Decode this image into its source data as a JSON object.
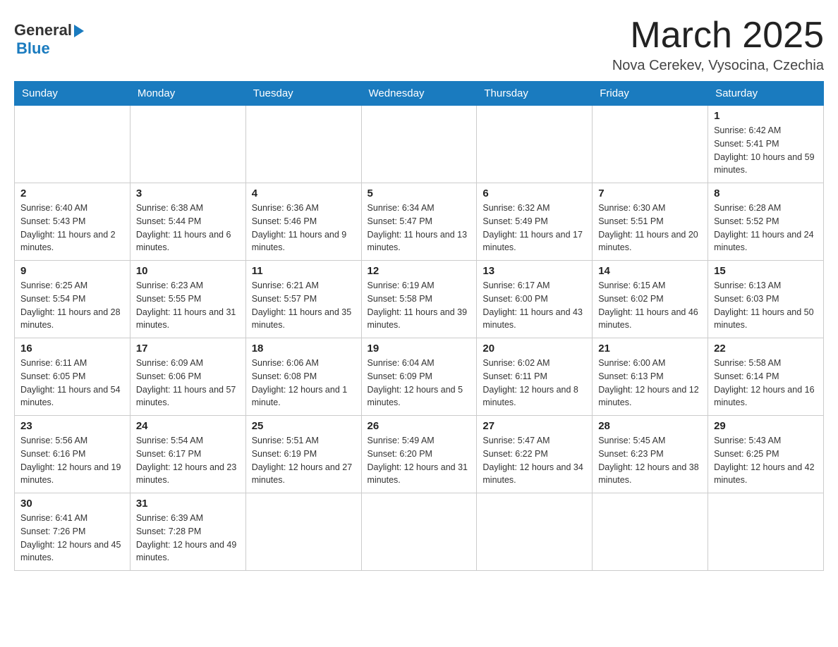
{
  "header": {
    "logo_general": "General",
    "logo_blue": "Blue",
    "month_title": "March 2025",
    "location": "Nova Cerekev, Vysocina, Czechia"
  },
  "weekdays": [
    "Sunday",
    "Monday",
    "Tuesday",
    "Wednesday",
    "Thursday",
    "Friday",
    "Saturday"
  ],
  "weeks": [
    [
      {
        "day": "",
        "info": ""
      },
      {
        "day": "",
        "info": ""
      },
      {
        "day": "",
        "info": ""
      },
      {
        "day": "",
        "info": ""
      },
      {
        "day": "",
        "info": ""
      },
      {
        "day": "",
        "info": ""
      },
      {
        "day": "1",
        "info": "Sunrise: 6:42 AM\nSunset: 5:41 PM\nDaylight: 10 hours and 59 minutes."
      }
    ],
    [
      {
        "day": "2",
        "info": "Sunrise: 6:40 AM\nSunset: 5:43 PM\nDaylight: 11 hours and 2 minutes."
      },
      {
        "day": "3",
        "info": "Sunrise: 6:38 AM\nSunset: 5:44 PM\nDaylight: 11 hours and 6 minutes."
      },
      {
        "day": "4",
        "info": "Sunrise: 6:36 AM\nSunset: 5:46 PM\nDaylight: 11 hours and 9 minutes."
      },
      {
        "day": "5",
        "info": "Sunrise: 6:34 AM\nSunset: 5:47 PM\nDaylight: 11 hours and 13 minutes."
      },
      {
        "day": "6",
        "info": "Sunrise: 6:32 AM\nSunset: 5:49 PM\nDaylight: 11 hours and 17 minutes."
      },
      {
        "day": "7",
        "info": "Sunrise: 6:30 AM\nSunset: 5:51 PM\nDaylight: 11 hours and 20 minutes."
      },
      {
        "day": "8",
        "info": "Sunrise: 6:28 AM\nSunset: 5:52 PM\nDaylight: 11 hours and 24 minutes."
      }
    ],
    [
      {
        "day": "9",
        "info": "Sunrise: 6:25 AM\nSunset: 5:54 PM\nDaylight: 11 hours and 28 minutes."
      },
      {
        "day": "10",
        "info": "Sunrise: 6:23 AM\nSunset: 5:55 PM\nDaylight: 11 hours and 31 minutes."
      },
      {
        "day": "11",
        "info": "Sunrise: 6:21 AM\nSunset: 5:57 PM\nDaylight: 11 hours and 35 minutes."
      },
      {
        "day": "12",
        "info": "Sunrise: 6:19 AM\nSunset: 5:58 PM\nDaylight: 11 hours and 39 minutes."
      },
      {
        "day": "13",
        "info": "Sunrise: 6:17 AM\nSunset: 6:00 PM\nDaylight: 11 hours and 43 minutes."
      },
      {
        "day": "14",
        "info": "Sunrise: 6:15 AM\nSunset: 6:02 PM\nDaylight: 11 hours and 46 minutes."
      },
      {
        "day": "15",
        "info": "Sunrise: 6:13 AM\nSunset: 6:03 PM\nDaylight: 11 hours and 50 minutes."
      }
    ],
    [
      {
        "day": "16",
        "info": "Sunrise: 6:11 AM\nSunset: 6:05 PM\nDaylight: 11 hours and 54 minutes."
      },
      {
        "day": "17",
        "info": "Sunrise: 6:09 AM\nSunset: 6:06 PM\nDaylight: 11 hours and 57 minutes."
      },
      {
        "day": "18",
        "info": "Sunrise: 6:06 AM\nSunset: 6:08 PM\nDaylight: 12 hours and 1 minute."
      },
      {
        "day": "19",
        "info": "Sunrise: 6:04 AM\nSunset: 6:09 PM\nDaylight: 12 hours and 5 minutes."
      },
      {
        "day": "20",
        "info": "Sunrise: 6:02 AM\nSunset: 6:11 PM\nDaylight: 12 hours and 8 minutes."
      },
      {
        "day": "21",
        "info": "Sunrise: 6:00 AM\nSunset: 6:13 PM\nDaylight: 12 hours and 12 minutes."
      },
      {
        "day": "22",
        "info": "Sunrise: 5:58 AM\nSunset: 6:14 PM\nDaylight: 12 hours and 16 minutes."
      }
    ],
    [
      {
        "day": "23",
        "info": "Sunrise: 5:56 AM\nSunset: 6:16 PM\nDaylight: 12 hours and 19 minutes."
      },
      {
        "day": "24",
        "info": "Sunrise: 5:54 AM\nSunset: 6:17 PM\nDaylight: 12 hours and 23 minutes."
      },
      {
        "day": "25",
        "info": "Sunrise: 5:51 AM\nSunset: 6:19 PM\nDaylight: 12 hours and 27 minutes."
      },
      {
        "day": "26",
        "info": "Sunrise: 5:49 AM\nSunset: 6:20 PM\nDaylight: 12 hours and 31 minutes."
      },
      {
        "day": "27",
        "info": "Sunrise: 5:47 AM\nSunset: 6:22 PM\nDaylight: 12 hours and 34 minutes."
      },
      {
        "day": "28",
        "info": "Sunrise: 5:45 AM\nSunset: 6:23 PM\nDaylight: 12 hours and 38 minutes."
      },
      {
        "day": "29",
        "info": "Sunrise: 5:43 AM\nSunset: 6:25 PM\nDaylight: 12 hours and 42 minutes."
      }
    ],
    [
      {
        "day": "30",
        "info": "Sunrise: 6:41 AM\nSunset: 7:26 PM\nDaylight: 12 hours and 45 minutes."
      },
      {
        "day": "31",
        "info": "Sunrise: 6:39 AM\nSunset: 7:28 PM\nDaylight: 12 hours and 49 minutes."
      },
      {
        "day": "",
        "info": ""
      },
      {
        "day": "",
        "info": ""
      },
      {
        "day": "",
        "info": ""
      },
      {
        "day": "",
        "info": ""
      },
      {
        "day": "",
        "info": ""
      }
    ]
  ]
}
